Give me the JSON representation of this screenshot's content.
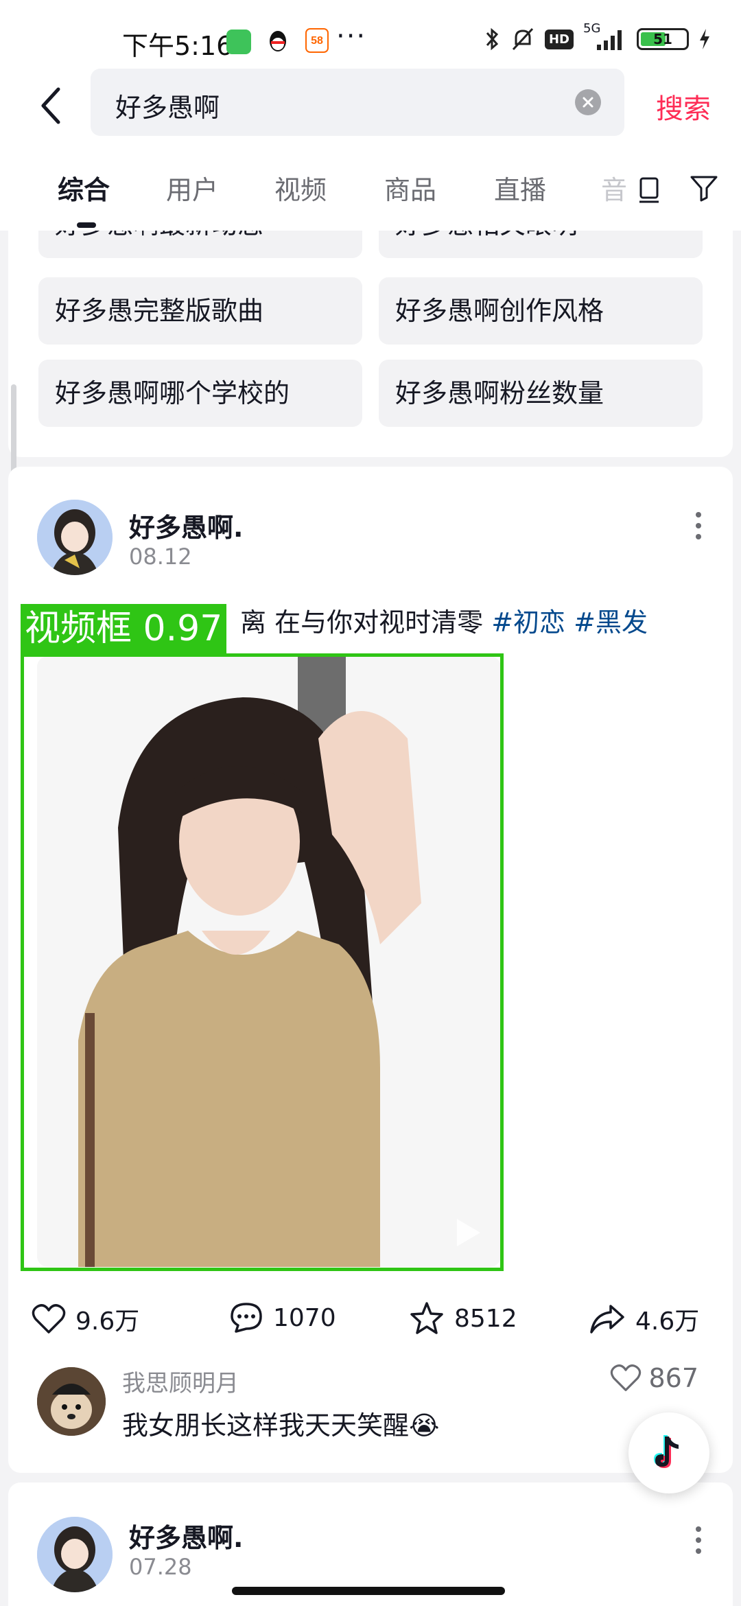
{
  "status_bar": {
    "time": "下午5:16",
    "network": "5G",
    "hd": "HD",
    "battery": "51",
    "more": "···"
  },
  "search": {
    "query": "好多愚啊",
    "submit_label": "搜索"
  },
  "tabs": [
    {
      "label": "综合",
      "active": true
    },
    {
      "label": "用户"
    },
    {
      "label": "视频"
    },
    {
      "label": "商品"
    },
    {
      "label": "直播"
    },
    {
      "label": "音"
    }
  ],
  "suggestions": [
    "好多愚啊最新动态",
    "好多愚相关眼明",
    "好多愚完整版歌曲",
    "好多愚啊创作风格",
    "好多愚啊哪个学校的",
    "好多愚啊粉丝数量"
  ],
  "post": {
    "author": "好多愚啊.",
    "date": "08.12",
    "caption_text": "离 在与你对视时清零",
    "tags": [
      "#初恋",
      "#黑发"
    ],
    "detection_label": "视频框 0.97",
    "stats": {
      "likes": "9.6万",
      "comments": "1070",
      "favorites": "8512",
      "shares": "4.6万"
    },
    "top_comment": {
      "user": "我思顾明月",
      "text": "我女朋长这样我天天笑醒😭",
      "likes": "867"
    }
  },
  "next_post": {
    "author": "好多愚啊.",
    "date": "07.28"
  },
  "colors": {
    "accent": "#fe2c55",
    "tag": "#04498d",
    "detection": "#2fc515"
  }
}
